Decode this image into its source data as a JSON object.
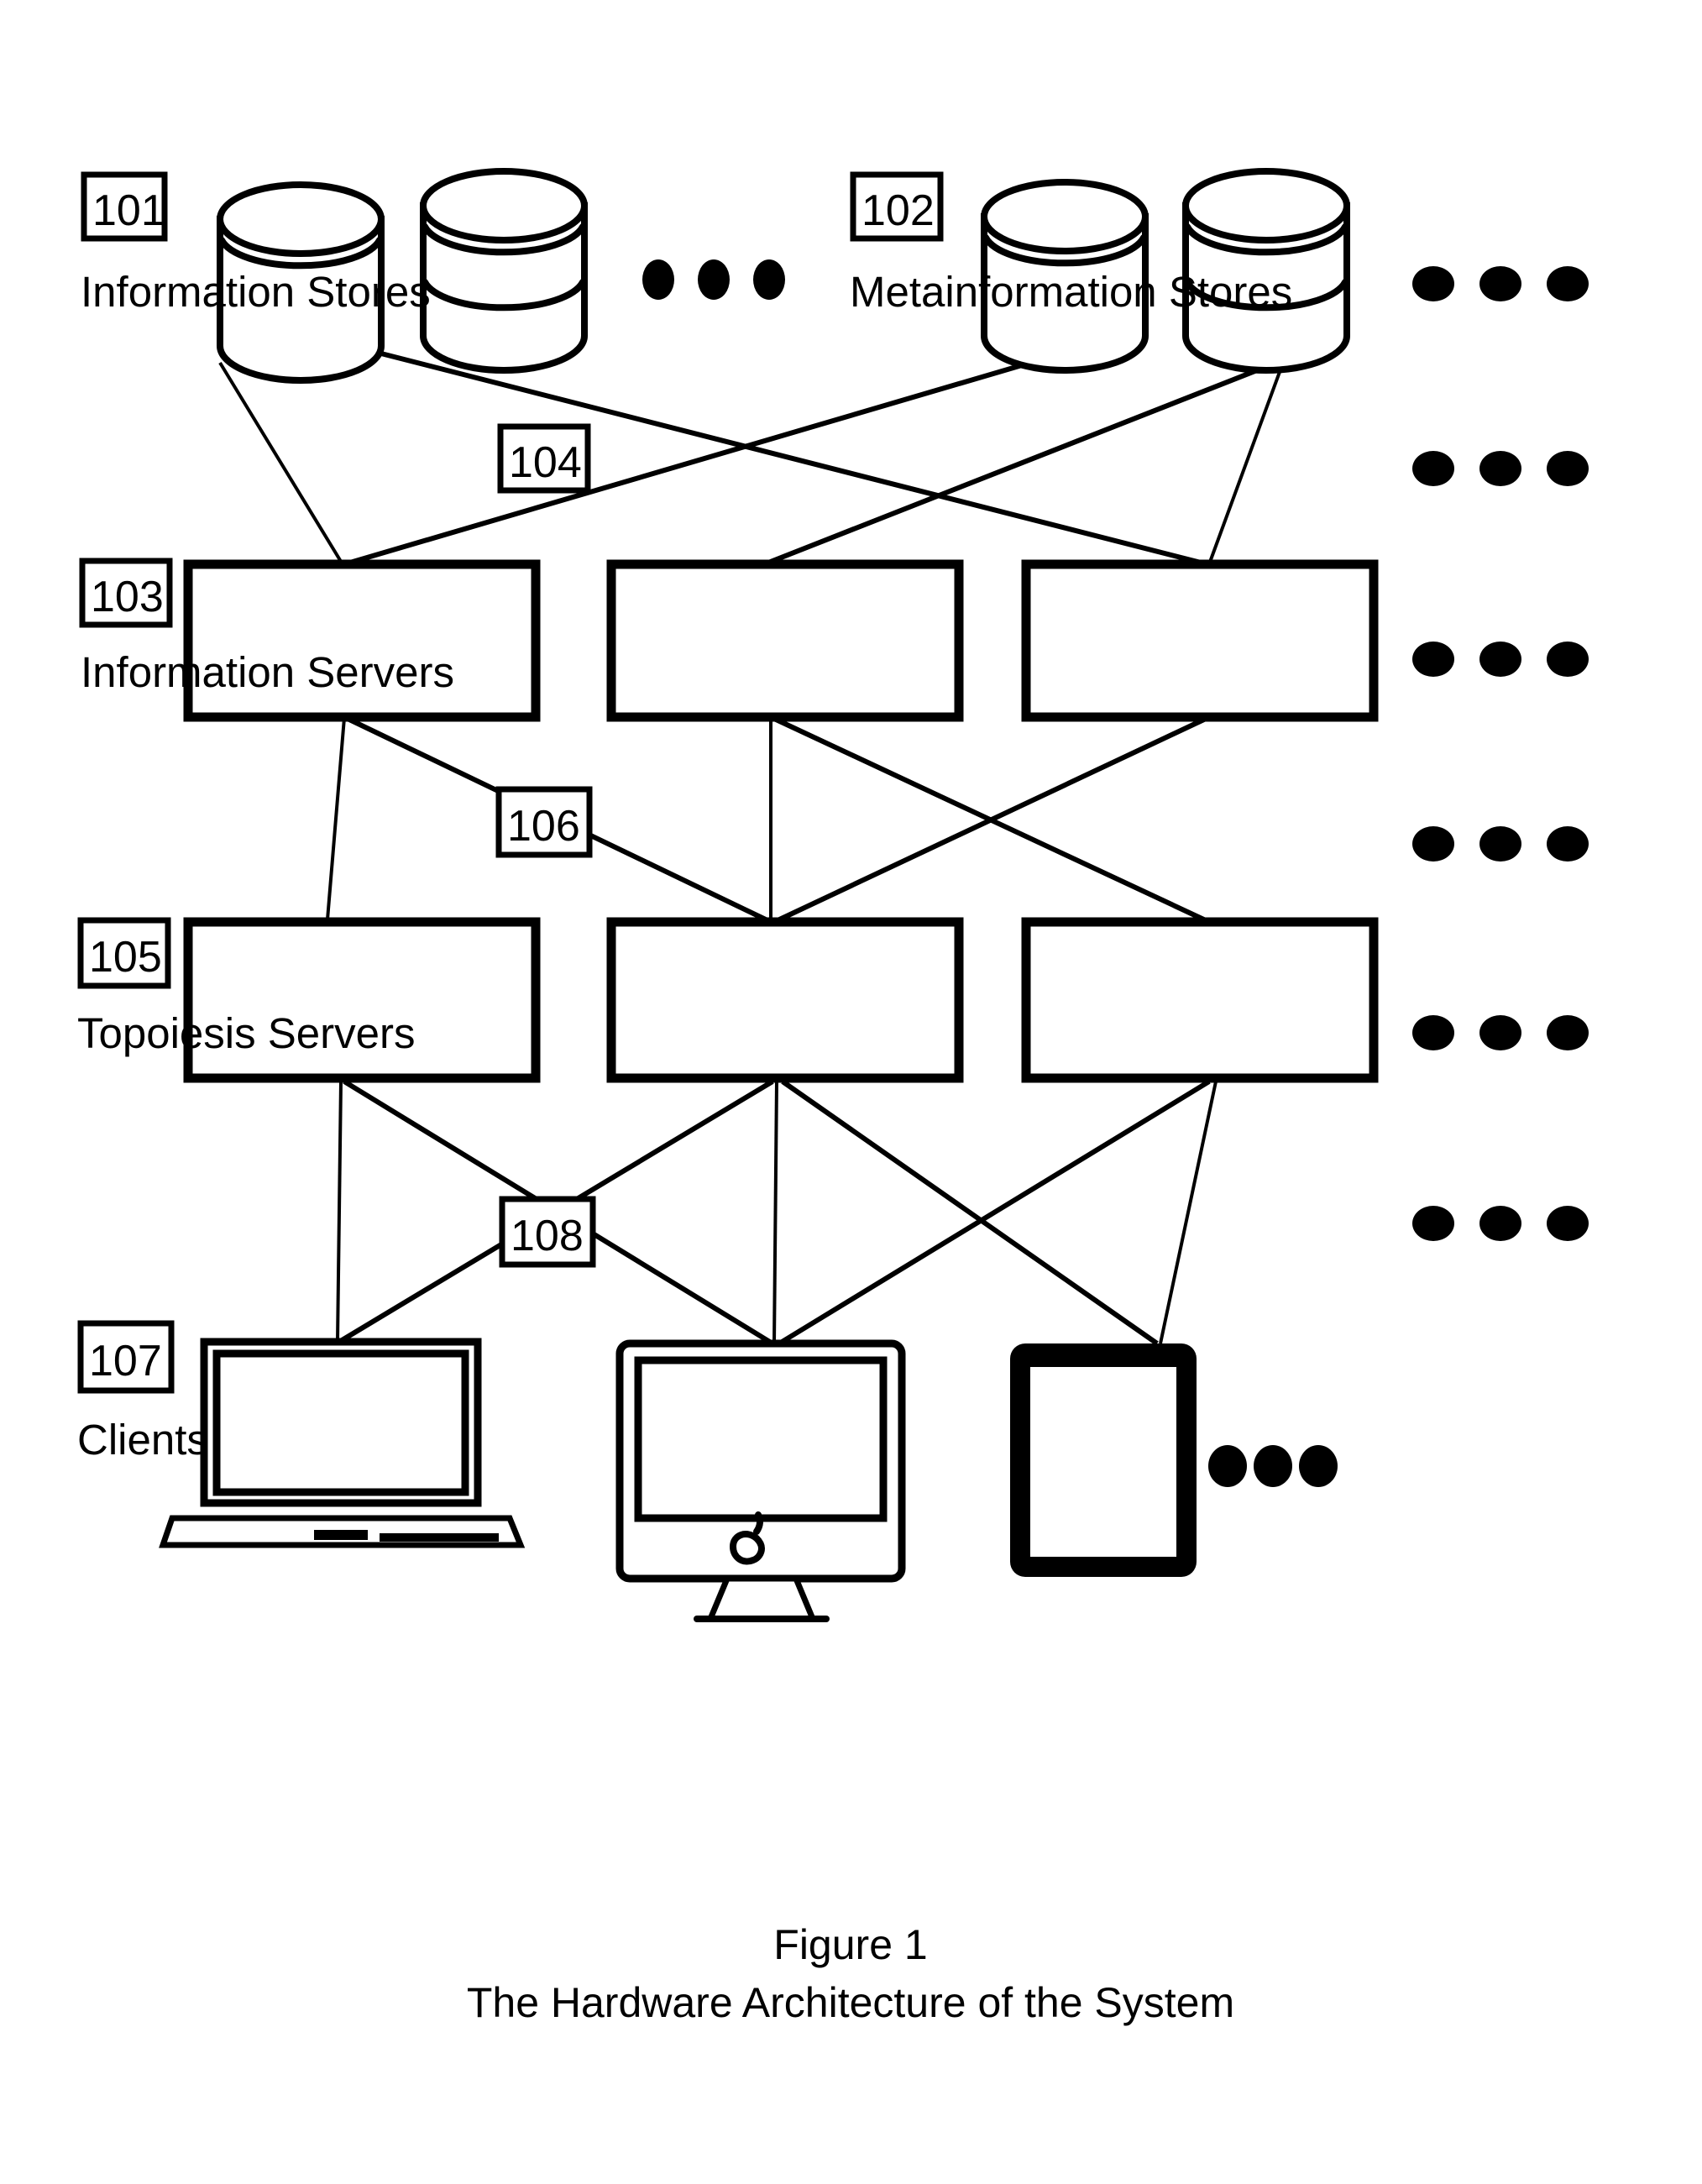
{
  "figure": {
    "caption_line1": "Figure 1",
    "caption_line2": "The Hardware Architecture of the System"
  },
  "layers": [
    {
      "ref": "101",
      "label": "Information Stores",
      "kind": "cylinder-row",
      "count_shown": 2,
      "ellipsis": "• • •"
    },
    {
      "ref": "102",
      "label": "Metainformation Stores",
      "kind": "cylinder-row",
      "count_shown": 2,
      "ellipsis": "• • •"
    },
    {
      "ref": "103",
      "label": "Information Servers",
      "kind": "box-row",
      "count_shown": 3,
      "ellipsis": "• • •"
    },
    {
      "ref": "105",
      "label": "Topoiesis Servers",
      "kind": "box-row",
      "count_shown": 3,
      "ellipsis": "• • •"
    },
    {
      "ref": "107",
      "label": "Clients",
      "kind": "device-row",
      "count_shown": 3,
      "ellipsis": "• • •",
      "devices": [
        "laptop",
        "desktop-monitor",
        "tablet"
      ]
    }
  ],
  "connections": [
    {
      "ref": "104",
      "from": "101/102",
      "to": "103",
      "description": "Stores to Information Servers network links"
    },
    {
      "ref": "106",
      "from": "103",
      "to": "105",
      "description": "Information Servers to Topoiesis Servers network links"
    },
    {
      "ref": "108",
      "from": "105",
      "to": "107",
      "description": "Topoiesis Servers to Clients network links"
    }
  ],
  "right_ellipses": [
    "• • •",
    "• • •",
    "• • •",
    "• • •",
    "• • •"
  ],
  "colors": {
    "ink": "#000000",
    "paper": "#ffffff"
  }
}
